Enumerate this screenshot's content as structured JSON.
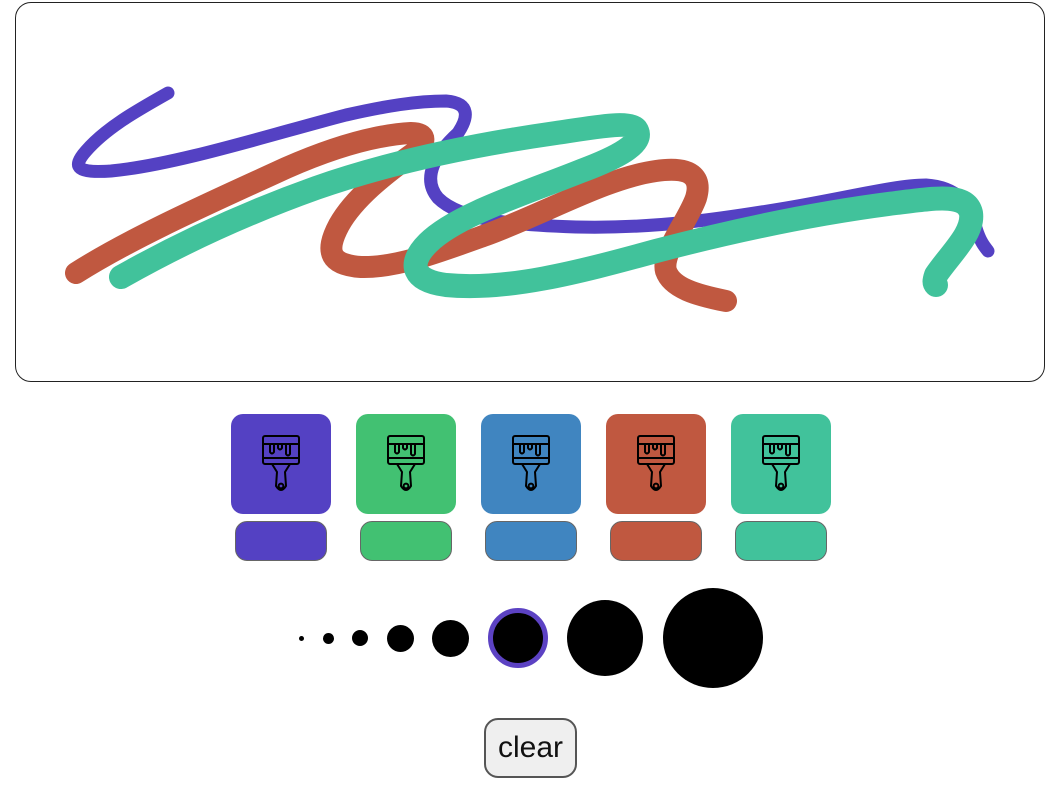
{
  "palette": [
    {
      "name": "purple",
      "color": "#5441c3",
      "icon": "paintbrush-icon"
    },
    {
      "name": "green",
      "color": "#42c172",
      "icon": "paintbrush-icon"
    },
    {
      "name": "blue",
      "color": "#4085c0",
      "icon": "paintbrush-icon"
    },
    {
      "name": "red",
      "color": "#c05840",
      "icon": "paintbrush-icon"
    },
    {
      "name": "teal",
      "color": "#41c29b",
      "icon": "paintbrush-icon"
    }
  ],
  "brush_sizes": {
    "count": 8,
    "selected_index": 5,
    "selected_ring_color": "#5c42c3"
  },
  "strokes_colors": [
    "#5441c3",
    "#c05840",
    "#41c29b"
  ],
  "clear_label": "clear"
}
